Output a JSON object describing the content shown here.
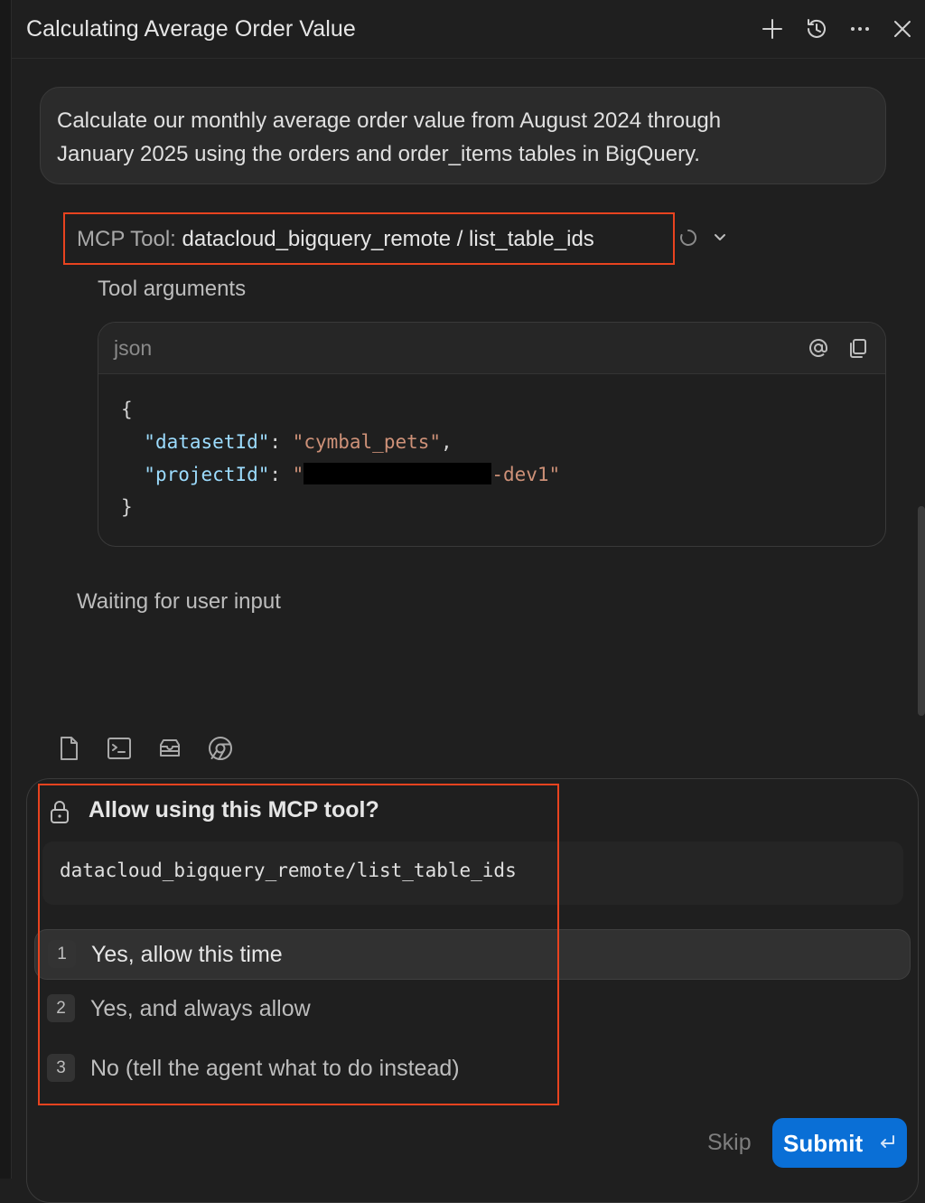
{
  "header": {
    "title": "Calculating Average Order Value"
  },
  "user_message": {
    "line1": "Calculate our monthly average order value from August 2024 through",
    "line2": "January 2025 using the orders and order_items tables in BigQuery."
  },
  "tool_call": {
    "prefix": "MCP Tool:",
    "name": "datacloud_bigquery_remote / list_table_ids",
    "args_label": "Tool arguments",
    "code_language": "json",
    "open_brace": "{",
    "close_brace": "}",
    "dataset_key": "\"datasetId\"",
    "dataset_value": "\"cymbal_pets\"",
    "project_key": "\"projectId\"",
    "project_value_start": "\"",
    "project_value_end": "-dev1\""
  },
  "status": {
    "waiting": "Waiting for user input"
  },
  "permission": {
    "question": "Allow using this MCP tool?",
    "tool": "datacloud_bigquery_remote/list_table_ids",
    "options": [
      {
        "num": "1",
        "label": "Yes, allow this time"
      },
      {
        "num": "2",
        "label": "Yes, and always allow"
      },
      {
        "num": "3",
        "label": "No (tell the agent what to do instead)"
      }
    ],
    "selected": "1"
  },
  "actions": {
    "skip": "Skip",
    "submit": "Submit"
  },
  "colors": {
    "accent": "#0a6fd6",
    "highlight_border": "#e8431f"
  },
  "icons": [
    "plus-icon",
    "history-icon",
    "more-icon",
    "close-icon",
    "spinner-icon",
    "chevron-down-icon",
    "at-icon",
    "copy-icon",
    "file-icon",
    "terminal-icon",
    "inbox-icon",
    "chrome-icon",
    "lock-icon",
    "enter-icon"
  ]
}
